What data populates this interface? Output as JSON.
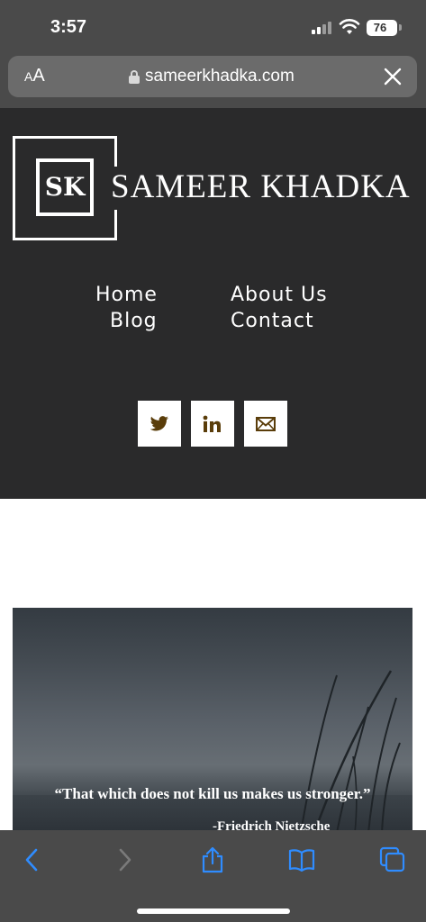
{
  "status_bar": {
    "time": "3:57",
    "battery": "76"
  },
  "browser": {
    "text_size_label_small": "A",
    "text_size_label_big": "A",
    "url": "sameerkhadka.com",
    "icons": {
      "lock": "lock-icon",
      "close": "close-icon"
    }
  },
  "site": {
    "logo_text": "SK",
    "title": "SAMEER KHADKA",
    "nav": {
      "home": "Home",
      "about": "About Us",
      "blog": "Blog",
      "contact": "Contact"
    },
    "social": [
      "twitter-icon",
      "linkedin-icon",
      "mail-icon"
    ],
    "social_icon_color": "#5a3d0a"
  },
  "hero": {
    "quote": "“That which does not kill us makes us stronger.”",
    "author": "-Friedrich Nietzsche"
  },
  "toolbar": {
    "items": [
      "back-icon",
      "forward-icon",
      "share-icon",
      "bookmarks-icon",
      "tabs-icon"
    ],
    "accent": "#2f8cff"
  }
}
